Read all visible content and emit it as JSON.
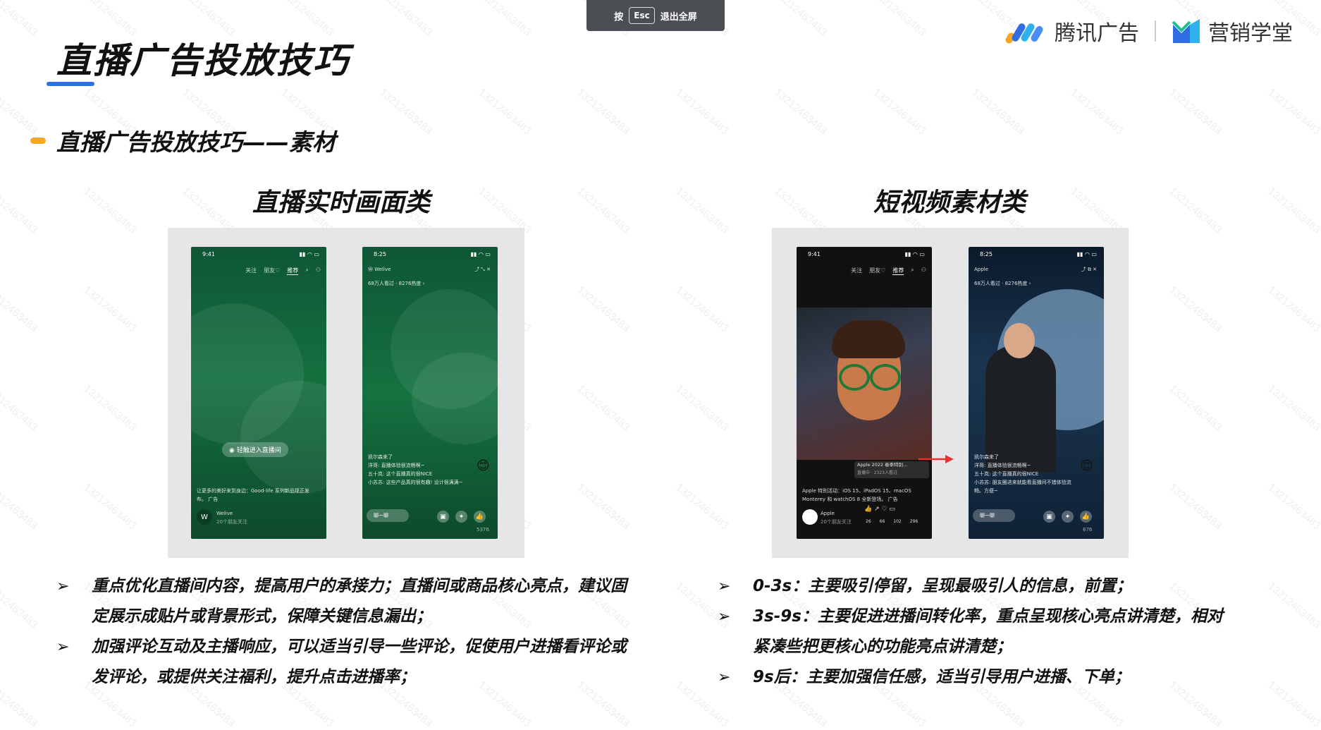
{
  "esc_hint": {
    "press": "按",
    "key": "Esc",
    "action": "退出全屏"
  },
  "brand": {
    "tencent_ads": "腾讯广告",
    "marketing_school": "营销学堂"
  },
  "page_title": "直播广告投放技巧",
  "section_title": "直播广告投放技巧——素材",
  "watermark": "13212463483",
  "left": {
    "title": "直播实时画面类",
    "phone1": {
      "time": "9:41",
      "nav": [
        "关注",
        "朋友♡",
        "推荐"
      ],
      "enter_button": "轻触进入直播间",
      "caption": "让更多的美好来到身边：Good-life 系列新品现正发布。",
      "ad_tag": "广告",
      "account": "Welive",
      "account_sub": "20个朋友关注"
    },
    "phone2": {
      "time": "8:25",
      "account": "Welive",
      "viewers": "68万人看过 · 8276热度 ›",
      "comments": [
        "凯尔森来了",
        "洋哥: 直播体验很流畅啊~",
        "五十岚: 这个直播真的很NICE",
        "小苏苏: 这些产品真的很有趣! 设计很满满~"
      ],
      "input_placeholder": "聊一聊",
      "likes": "5376"
    },
    "bullets": [
      "重点优化直播间内容，提高用户的承接力；直播间或商品核心亮点，建议固定展示成贴片或背景形式，保障关键信息漏出；",
      "加强评论互动及主播响应，可以适当引导一些评论，促使用户进播看评论或发评论，或提供关注福利，提升点击进播率；"
    ]
  },
  "right": {
    "title": "短视频素材类",
    "phone1": {
      "time": "9:41",
      "nav": [
        "关注",
        "朋友♡",
        "推荐"
      ],
      "live_card": "Apple 2022 春季特别...",
      "live_card_sub": "直播中 · 2323人看过",
      "caption": "Apple 特别活动：iOS 15、iPadOS 15、macOS Monterey 和 watchOS 8 全新登场。",
      "ad_tag": "广告",
      "account": "Apple",
      "account_sub": "20个朋友关注",
      "counts": [
        "26",
        "66",
        "102",
        "296"
      ]
    },
    "phone2": {
      "time": "8:25",
      "account": "Apple",
      "viewers": "68万人看过 · 8276热度 ›",
      "comments": [
        "凯尔森来了",
        "洋哥: 直播体验很流畅啊~",
        "五十岚: 这个直播真的很NICE",
        "小苏苏: 朋友圈进来就能看直播间不错体验流畅。方便~"
      ],
      "input_placeholder": "聊一聊",
      "likes": "876"
    },
    "bullets": [
      "0-3s：主要吸引停留，呈现最吸引人的信息，前置；",
      "3s-9s：主要促进进播间转化率，重点呈现核心亮点讲清楚，相对紧凑些把更核心的功能亮点讲清楚；",
      "9s后：主要加强信任感，适当引导用户进播、下单；"
    ]
  },
  "colors": {
    "accent_blue": "#2f6de2",
    "accent_orange": "#f5a623",
    "live_green": "#0f5c3a",
    "arrow_red": "#e8322b"
  }
}
